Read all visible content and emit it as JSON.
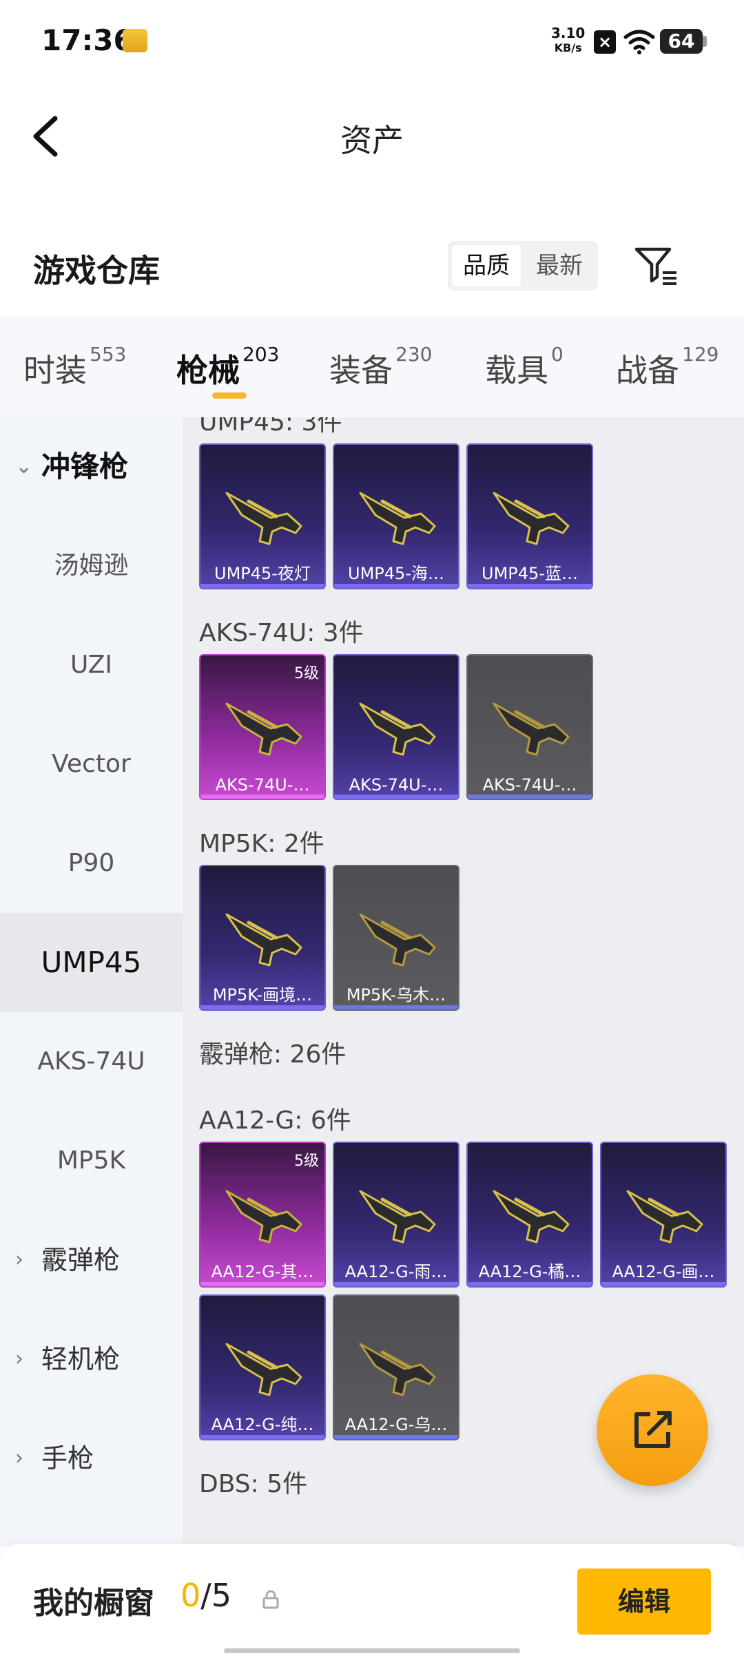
{
  "status_bar": {
    "time": "17:36",
    "net_speed_value": "3.10",
    "net_speed_unit": "KB/s",
    "battery": "64"
  },
  "nav": {
    "title": "资产"
  },
  "warehouse": {
    "title": "游戏仓库",
    "sort_options": [
      "品质",
      "最新"
    ],
    "active_sort": "品质"
  },
  "tabs": [
    {
      "label": "时装",
      "count": "553"
    },
    {
      "label": "枪械",
      "count": "203",
      "active": true
    },
    {
      "label": "装备",
      "count": "230"
    },
    {
      "label": "载具",
      "count": "0"
    },
    {
      "label": "战备",
      "count": "129"
    }
  ],
  "sidebar": {
    "categories": [
      {
        "label": "冲锋枪",
        "expanded": true
      },
      {
        "label": "霰弹枪"
      },
      {
        "label": "轻机枪"
      },
      {
        "label": "手枪"
      }
    ],
    "sub_items": [
      "汤姆逊",
      "UZI",
      "Vector",
      "P90",
      "UMP45",
      "AKS-74U",
      "MP5K"
    ],
    "active_sub": "UMP45"
  },
  "groups": [
    {
      "title": "UMP45: 3件",
      "items": [
        {
          "name": "UMP45-夜灯",
          "rarity": "blue"
        },
        {
          "name": "UMP45-海…",
          "rarity": "blue"
        },
        {
          "name": "UMP45-蓝…",
          "rarity": "blue"
        }
      ]
    },
    {
      "title": "AKS-74U: 3件",
      "items": [
        {
          "name": "AKS-74U-…",
          "rarity": "pink",
          "level": "5级"
        },
        {
          "name": "AKS-74U-…",
          "rarity": "blue"
        },
        {
          "name": "AKS-74U-…",
          "rarity": "gray"
        }
      ]
    },
    {
      "title": "MP5K: 2件",
      "items": [
        {
          "name": "MP5K-画境…",
          "rarity": "blue"
        },
        {
          "name": "MP5K-乌木…",
          "rarity": "gray"
        }
      ]
    },
    {
      "title": "霰弹枪: 26件"
    },
    {
      "title": "AA12-G: 6件",
      "items": [
        {
          "name": "AA12-G-其…",
          "rarity": "pink",
          "level": "5级"
        },
        {
          "name": "AA12-G-雨…",
          "rarity": "blue"
        },
        {
          "name": "AA12-G-橘…",
          "rarity": "blue"
        },
        {
          "name": "AA12-G-画…",
          "rarity": "blue"
        },
        {
          "name": "AA12-G-纯…",
          "rarity": "blue"
        },
        {
          "name": "AA12-G-乌…",
          "rarity": "gray"
        }
      ]
    },
    {
      "title": "DBS: 5件"
    }
  ],
  "bottom": {
    "label": "我的橱窗",
    "current": "0",
    "total": "/5",
    "edit_label": "编辑"
  },
  "colors": {
    "accent": "#ffb800",
    "rarity_blue": "#5342a8",
    "rarity_pink": "#c84ad2",
    "rarity_gray": "#5b5b60"
  }
}
